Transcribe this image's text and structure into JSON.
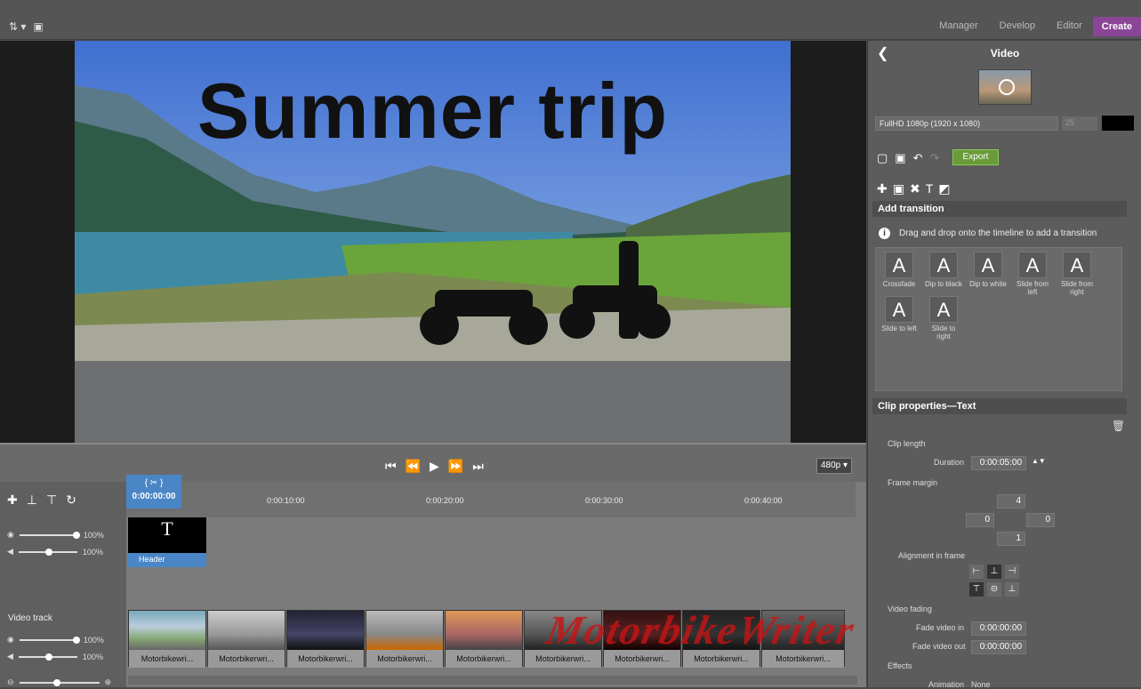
{
  "nav": {
    "tabs": [
      "Manager",
      "Develop",
      "Editor",
      "Create"
    ]
  },
  "preview": {
    "title_text": "Summer trip"
  },
  "transport": {
    "resolution": "480p ▾"
  },
  "timeline": {
    "timecode": "0:00:00:00",
    "ticks": [
      "0:00:10:00",
      "0:00:20:00",
      "0:00:30:00",
      "0:00:40:00"
    ],
    "volume1": "100%",
    "volume2": "100%",
    "volume3": "100%",
    "volume4": "100%",
    "header_clip": "Header",
    "video_track": "Video track",
    "clips": [
      "Motorbikewri...",
      "Motorbikerwri...",
      "Motorbikerwri...",
      "Motorbikerwri...",
      "Motorbikerwri...",
      "Motorbikerwri...",
      "Motorbikerwri...",
      "Motorbikerwri...",
      "Motorbikerwri..."
    ]
  },
  "panel": {
    "title": "Video",
    "format": "FullHD 1080p (1920 x 1080)",
    "fps": "25",
    "export": "Export",
    "add_transition": "Add transition",
    "info": "Drag and drop onto the timeline to add a transition",
    "transitions": [
      "Crossfade",
      "Dip to black",
      "Dip to white",
      "Slide from left",
      "Slide from right",
      "Slide to left",
      "Slide to right"
    ],
    "clip_props": "Clip properties—Text",
    "clip_length": "Clip length",
    "duration_label": "Duration",
    "duration": "0:00:05:00",
    "frame_margin": "Frame margin",
    "margin_top": "4",
    "margin_left": "0",
    "margin_right": "0",
    "margin_bottom": "1",
    "alignment": "Alignment in frame",
    "video_fading": "Video fading",
    "fade_in_label": "Fade video in",
    "fade_in": "0:00:00:00",
    "fade_out_label": "Fade video out",
    "fade_out": "0:00:00:00",
    "effects": "Effects",
    "animation_label": "Animation",
    "animation": "None"
  },
  "watermark": "MotorbikeWriter"
}
